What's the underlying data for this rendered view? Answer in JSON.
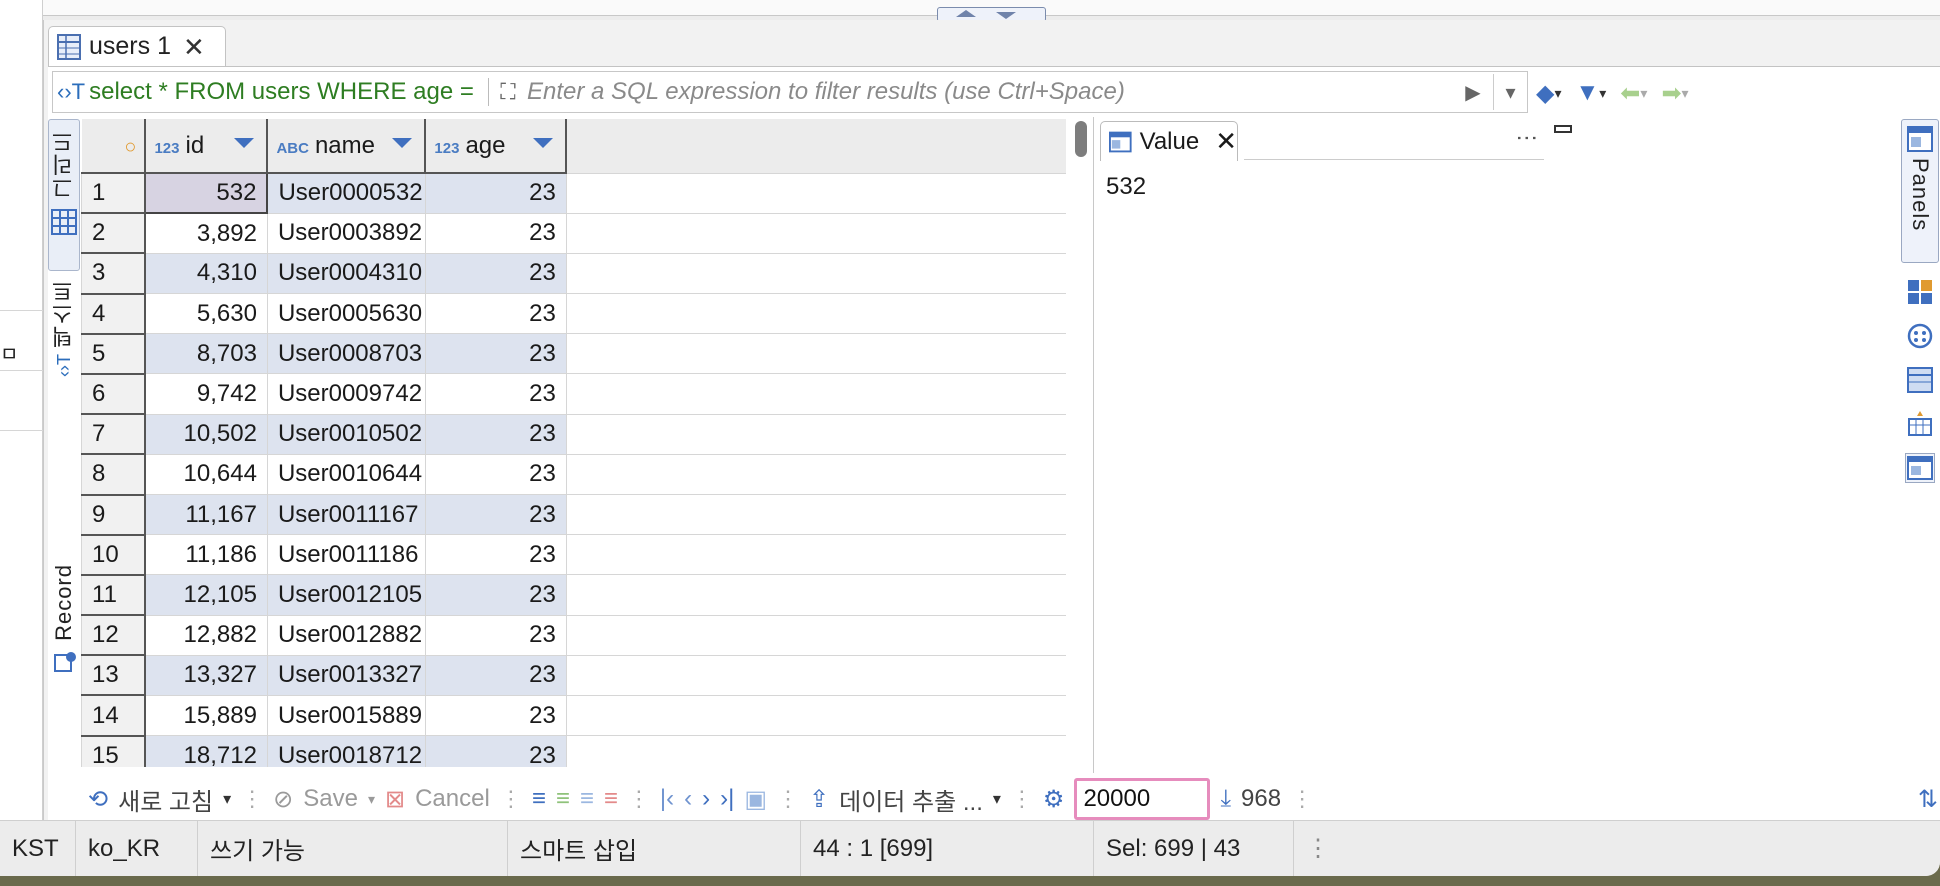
{
  "editor_tab": {
    "label": "users 1"
  },
  "filter": {
    "current_query": "select * FROM users WHERE age =",
    "placeholder": "Enter a SQL expression to filter results (use Ctrl+Space)"
  },
  "side_tabs": {
    "grid": "그리드",
    "text": "텍스트",
    "record": "Record"
  },
  "grid": {
    "columns": [
      {
        "type": "123",
        "name": "id"
      },
      {
        "type": "ABC",
        "name": "name"
      },
      {
        "type": "123",
        "name": "age"
      }
    ],
    "rows": [
      {
        "n": "1",
        "id": "532",
        "name": "User0000532",
        "age": "23"
      },
      {
        "n": "2",
        "id": "3,892",
        "name": "User0003892",
        "age": "23"
      },
      {
        "n": "3",
        "id": "4,310",
        "name": "User0004310",
        "age": "23"
      },
      {
        "n": "4",
        "id": "5,630",
        "name": "User0005630",
        "age": "23"
      },
      {
        "n": "5",
        "id": "8,703",
        "name": "User0008703",
        "age": "23"
      },
      {
        "n": "6",
        "id": "9,742",
        "name": "User0009742",
        "age": "23"
      },
      {
        "n": "7",
        "id": "10,502",
        "name": "User0010502",
        "age": "23"
      },
      {
        "n": "8",
        "id": "10,644",
        "name": "User0010644",
        "age": "23"
      },
      {
        "n": "9",
        "id": "11,167",
        "name": "User0011167",
        "age": "23"
      },
      {
        "n": "10",
        "id": "11,186",
        "name": "User0011186",
        "age": "23"
      },
      {
        "n": "11",
        "id": "12,105",
        "name": "User0012105",
        "age": "23"
      },
      {
        "n": "12",
        "id": "12,882",
        "name": "User0012882",
        "age": "23"
      },
      {
        "n": "13",
        "id": "13,327",
        "name": "User0013327",
        "age": "23"
      },
      {
        "n": "14",
        "id": "15,889",
        "name": "User0015889",
        "age": "23"
      },
      {
        "n": "15",
        "id": "18,712",
        "name": "User0018712",
        "age": "23"
      }
    ]
  },
  "value_panel": {
    "title": "Value",
    "value": "532"
  },
  "panels_label": "Panels",
  "toolbar": {
    "refresh": "새로 고침",
    "save": "Save",
    "cancel": "Cancel",
    "export": "데이터 추출 ...",
    "fetch_size": "20000",
    "row_count": "968"
  },
  "status": {
    "timezone": "KST",
    "locale": "ko_KR",
    "mode": "쓰기 가능",
    "insert_mode": "스마트 삽입",
    "cursor": "44 : 1 [699]",
    "selection": "Sel: 699 | 43"
  },
  "left_fragment": "ㅁ",
  "colors": {
    "accent": "#3f6fbf",
    "row_alt": "#dde3ef",
    "sql_green": "#2e7d22",
    "highlight": "#e68cbd"
  }
}
